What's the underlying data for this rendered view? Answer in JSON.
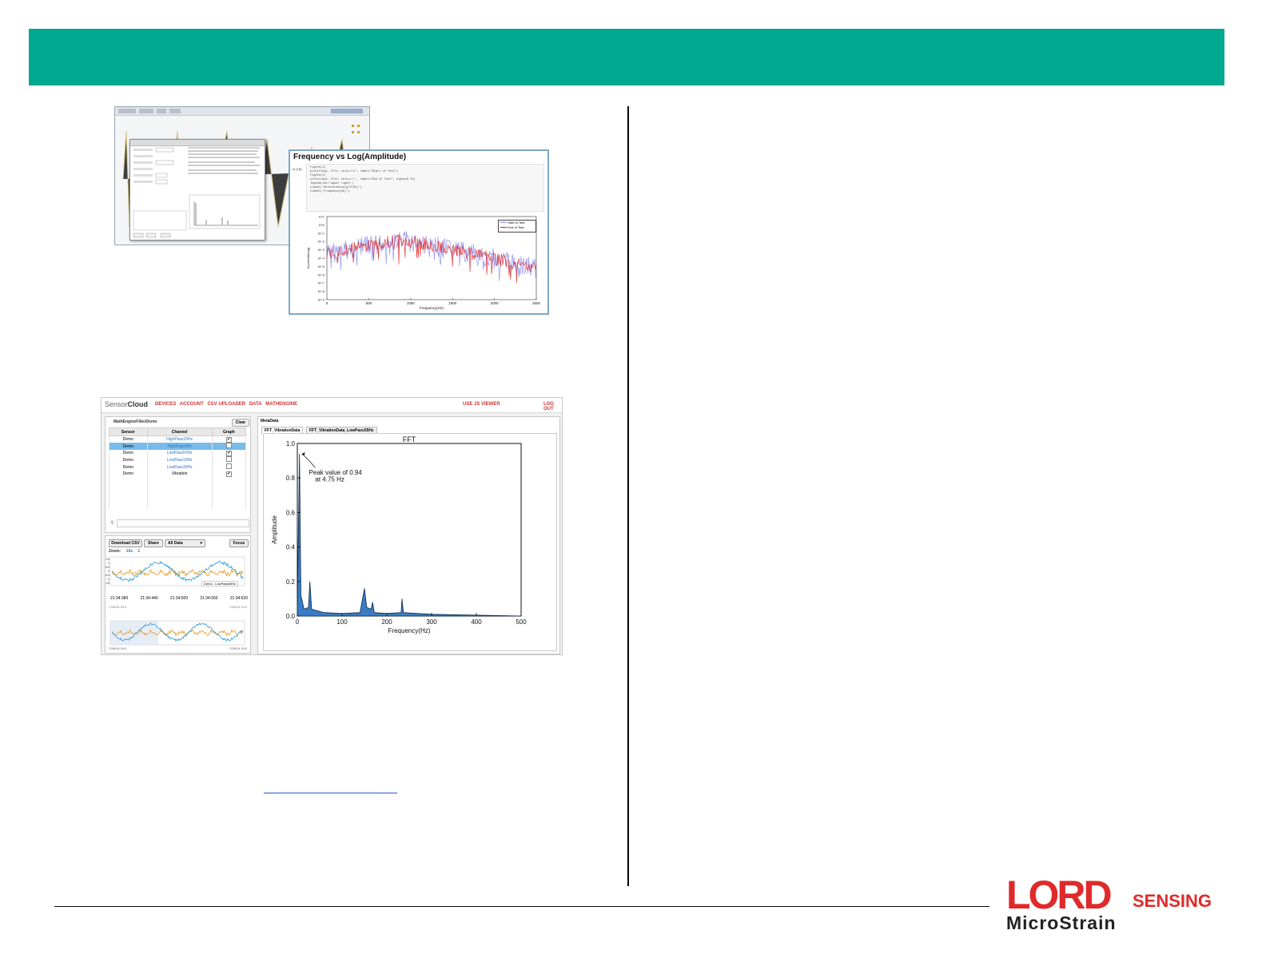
{
  "figure1": {
    "plot_title": "Frequency vs Log(Amplitude)",
    "code_prompt": "In [15]:",
    "code_lines": [
      "figure(1)",
      "plot(freq1, fft1, color='b', label=\"Start of Test\")",
      "figure(1)",
      "plot(freq2, fft2, color='r', label=\"End of Test\", alpha=0.75)",
      "legend(loc='upper right')",
      "ylabel('Acceleration(g^2/Hz)')",
      "xlabel('Frequency(Hz)')"
    ],
    "legend": [
      "Start of Test",
      "End of Test"
    ],
    "xlabel": "Frequency(Hz)",
    "ylabel": "Acceleration(g)",
    "x_ticks": [
      "0",
      "500",
      "1000",
      "1500",
      "2000",
      "2500"
    ],
    "y_ticks": [
      "10^1",
      "10^0",
      "10^-1",
      "10^-2",
      "10^-3",
      "10^-4",
      "10^-5",
      "10^-6",
      "10^-7",
      "10^-8",
      "10^-9"
    ],
    "colors": {
      "start": "#8a8ef0",
      "end": "#e01818",
      "frame": "#7fa7c9"
    }
  },
  "figure2": {
    "app_name_light": "Sensor",
    "app_name_bold": "Cloud",
    "nav": [
      "DEVICES",
      "ACCOUNT",
      "CSV UPLOADER",
      "DATA",
      "MATHENGINE"
    ],
    "use_viewer": "USE JS VIEWER",
    "logout": "LOG OUT",
    "left_panel_title": "MathEngineFilterDemo",
    "clear_button": "Clear",
    "table_headers": [
      "Sensor",
      "Channel",
      "Graph"
    ],
    "table_rows": [
      {
        "sensor": "Demo",
        "channel": "HighPass15Hz",
        "graph": "✔"
      },
      {
        "sensor": "Demo",
        "channel": "HighPass5Hz",
        "graph": ""
      },
      {
        "sensor": "Demo",
        "channel": "LowPass55Hz",
        "graph": "✔"
      },
      {
        "sensor": "Demo",
        "channel": "LowPass10Hz",
        "graph": ""
      },
      {
        "sensor": "Demo",
        "channel": "LowPass30Hz",
        "graph": ""
      },
      {
        "sensor": "Demo",
        "channel": "Vibration",
        "graph": "✔"
      }
    ],
    "download_csv": "Download CSV",
    "share": "Share",
    "all_data": "All Data",
    "focus": "Focus",
    "zoom_label": "Zoom:",
    "zoom_options": [
      "10s",
      "1"
    ],
    "time_labels": [
      "21:34:380",
      "21:34:440",
      "21:34:500",
      "21:34:560",
      "21:34:620"
    ],
    "timeline_start": "7/28/15 15:0",
    "timeline_end": "7/28/15 15:0",
    "legend_item": "Demo - LowPass55Hz",
    "right_panel_title": "MetaData",
    "tabs": [
      "FFT_VibrationData",
      "FFT_VibrationData_LowPass55Hz"
    ],
    "fft": {
      "title": "FFT",
      "annotation_line1": "Peak value of 0.94",
      "annotation_line2": "at 4.75 Hz",
      "xlabel": "Frequency(Hz)",
      "ylabel": "Amplitude",
      "x_ticks": [
        "0",
        "100",
        "200",
        "300",
        "400",
        "500"
      ],
      "y_ticks": [
        "0.0",
        "0.2",
        "0.4",
        "0.6",
        "0.8",
        "1.0"
      ]
    }
  },
  "logo": {
    "main": "LORD",
    "sub": "SENSING",
    "brand": "MicroStrain"
  },
  "chart_data": [
    {
      "type": "area",
      "title": "FFT",
      "xlabel": "Frequency(Hz)",
      "ylabel": "Amplitude",
      "xlim": [
        0,
        500
      ],
      "ylim": [
        0.0,
        1.0
      ],
      "x": [
        0,
        4.75,
        8,
        15,
        25,
        28,
        32,
        60,
        100,
        140,
        150,
        155,
        165,
        168,
        172,
        200,
        232,
        234,
        237,
        300,
        400,
        500
      ],
      "values": [
        0.05,
        0.94,
        0.12,
        0.04,
        0.05,
        0.2,
        0.04,
        0.02,
        0.015,
        0.02,
        0.16,
        0.05,
        0.04,
        0.08,
        0.02,
        0.015,
        0.02,
        0.1,
        0.02,
        0.01,
        0.005,
        0.0
      ],
      "series": [
        {
          "values": []
        }
      ]
    }
  ]
}
